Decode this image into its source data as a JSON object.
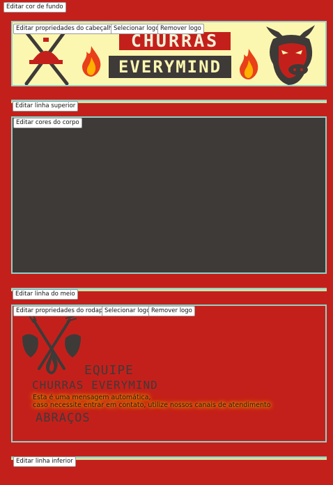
{
  "toolbar": {
    "background_button": "Editar cor de fundo"
  },
  "header": {
    "edit_button": "Editar propriedades do cabeçalho",
    "select_logo_button": "Selecionar logo",
    "remove_logo_button": "Remover logo",
    "banner_top": "CHURRAS",
    "banner_bottom": "EVERYMIND"
  },
  "top_line": {
    "edit_button": "Editar linha superior"
  },
  "body": {
    "edit_button": "Editar cores do corpo"
  },
  "middle_line": {
    "edit_button": "Editar linha do meio"
  },
  "footer": {
    "edit_button": "Editar propriedades do rodapé",
    "select_logo_button": "Selecionar logo",
    "remove_logo_button": "Remover logo",
    "team_text": "EQUIPE",
    "brand_text": "CHURRAS EVERYMIND",
    "message_line1": "Esta é uma mensagem automática,",
    "message_line2": "caso necessite entrar em contato, utilize nossos canais de atendimento",
    "farewell": "ABRAÇOS"
  },
  "bottom_line": {
    "edit_button": "Editar linha inferior"
  },
  "colors": {
    "page_background": "#c4201b",
    "header_background": "#fcf7b0",
    "body_background": "#3e3a38",
    "panel_border": "#8fd3c9",
    "flame_outer": "#e8401a",
    "flame_inner": "#ffb000"
  },
  "icons": [
    "grill-tools-icon",
    "flame-icon",
    "bull-head-icon",
    "crossed-forks-icon"
  ]
}
